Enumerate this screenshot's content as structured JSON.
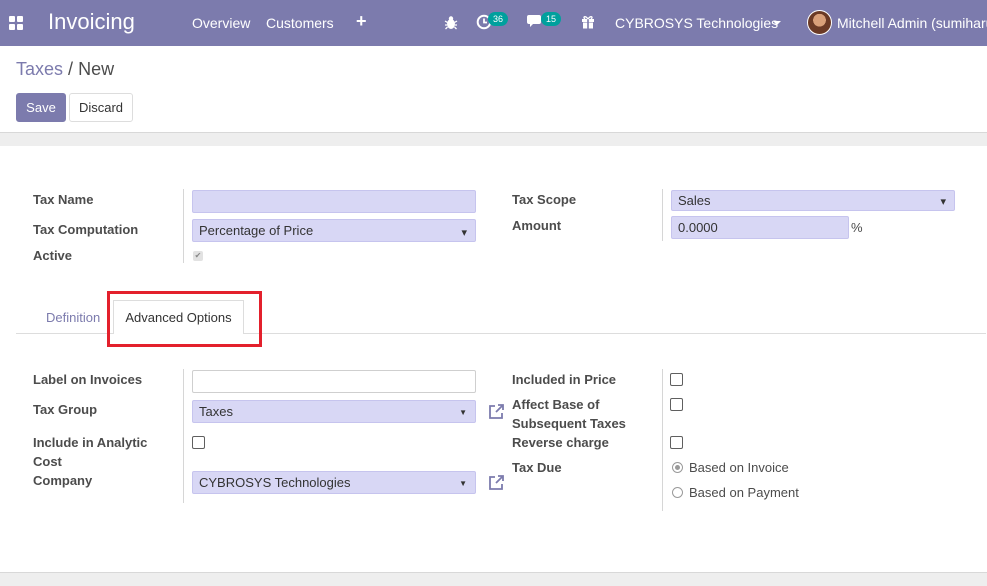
{
  "navbar": {
    "app_name": "Invoicing",
    "menu": [
      "Overview",
      "Customers"
    ],
    "plus_icon": "+",
    "activity_count": "36",
    "message_count": "15",
    "company": "CYBROSYS Technologies",
    "user": "Mitchell Admin (sumiharu"
  },
  "breadcrumb": {
    "parent": "Taxes",
    "separator": "/",
    "current": "New"
  },
  "buttons": {
    "save": "Save",
    "discard": "Discard"
  },
  "form": {
    "tax_name_label": "Tax Name",
    "tax_name_value": "",
    "tax_computation_label": "Tax Computation",
    "tax_computation_value": "Percentage of Price",
    "active_label": "Active",
    "active_checked": true,
    "tax_scope_label": "Tax Scope",
    "tax_scope_value": "Sales",
    "amount_label": "Amount",
    "amount_value": "0.0000",
    "amount_unit": "%"
  },
  "tabs": {
    "definition": "Definition",
    "advanced_options": "Advanced Options",
    "active": "advanced_options"
  },
  "advanced": {
    "label_on_invoices_label": "Label on Invoices",
    "label_on_invoices_value": "",
    "tax_group_label": "Tax Group",
    "tax_group_value": "Taxes",
    "include_analytic_line1": "Include in Analytic",
    "include_analytic_line2": "Cost",
    "company_label": "Company",
    "company_value": "CYBROSYS Technologies",
    "included_in_price_label": "Included in Price",
    "affect_base_line1": "Affect Base of",
    "affect_base_line2": "Subsequent Taxes",
    "reverse_charge_label": "Reverse charge",
    "tax_due_label": "Tax Due",
    "tax_due_options": [
      "Based on Invoice",
      "Based on Payment"
    ],
    "tax_due_selected": "Based on Invoice"
  },
  "colors": {
    "brand": "#7c7bad",
    "field_bg": "#d8d7f5",
    "badge": "#00a09d",
    "highlight": "#e3202c"
  }
}
